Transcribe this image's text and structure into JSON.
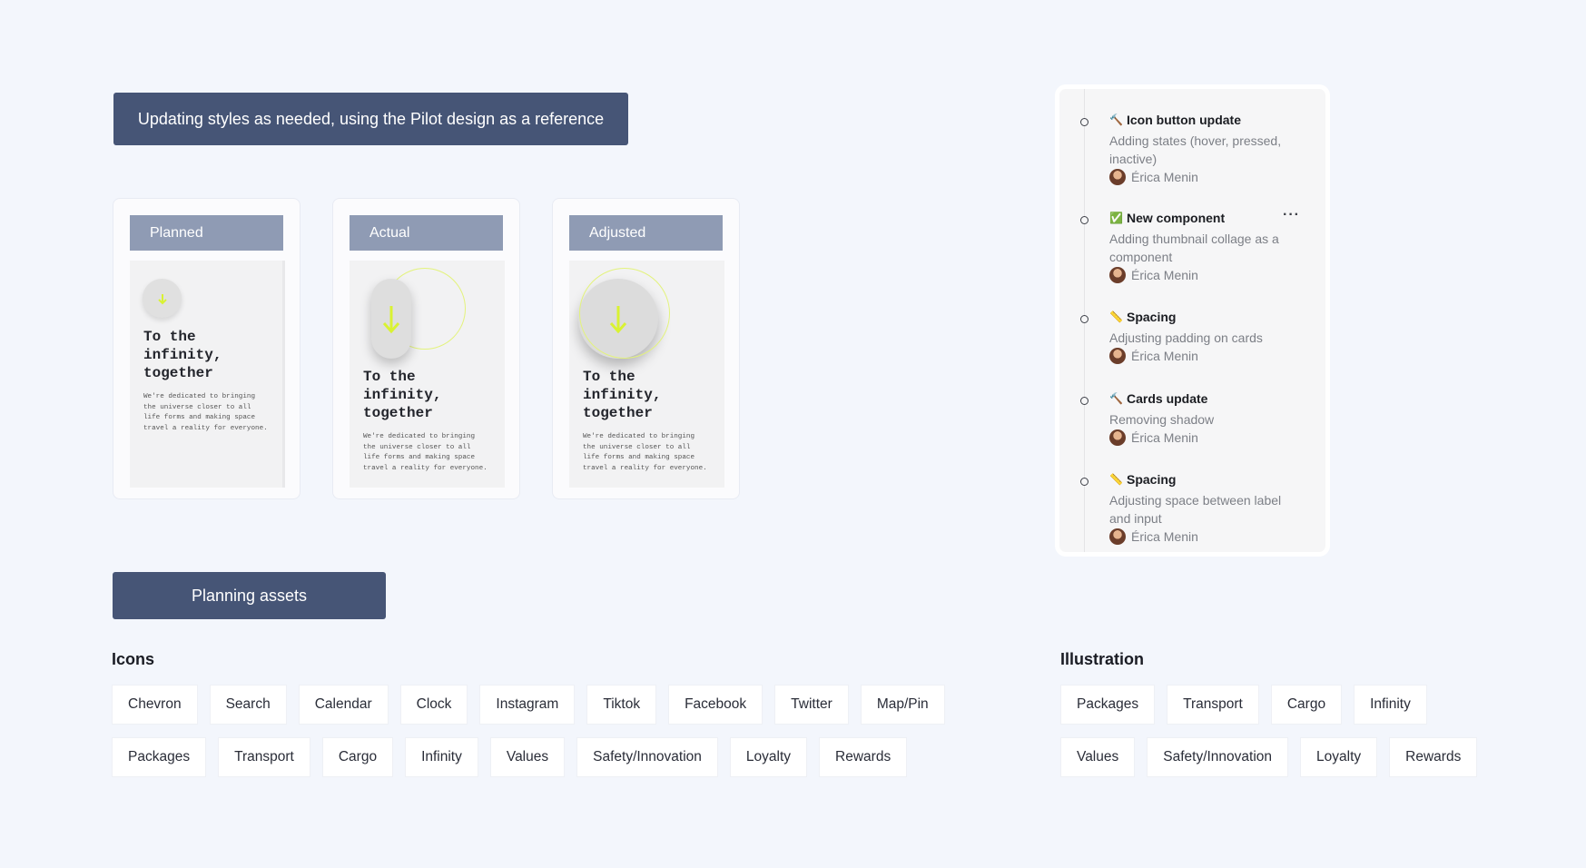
{
  "header": {
    "banner": "Updating styles as needed, using the Pilot design as a reference"
  },
  "cards": [
    {
      "label": "Planned",
      "title_lines": [
        "To the",
        "infinity,",
        "together"
      ],
      "text_lines": [
        "We're dedicated to bringing",
        "the universe closer to all",
        "life forms and making space",
        "travel a reality for everyone."
      ],
      "icon": "arrow-down-icon"
    },
    {
      "label": "Actual",
      "title_lines": [
        "To the",
        "infinity,",
        "together"
      ],
      "text_lines": [
        "We're dedicated to bringing",
        "the universe closer to all",
        "life forms and making space",
        "travel a reality for everyone."
      ],
      "icon": "arrow-down-icon"
    },
    {
      "label": "Adjusted",
      "title_lines": [
        "To the",
        "infinity,",
        "together"
      ],
      "text_lines": [
        "We're dedicated to bringing",
        "the universe closer to all",
        "life forms and making space",
        "travel a reality for everyone."
      ],
      "icon": "arrow-down-icon"
    }
  ],
  "activity": [
    {
      "emoji": "🔨",
      "title": "Icon button update",
      "description": "Adding states (hover, pressed, inactive)",
      "author": "Érica Menin"
    },
    {
      "emoji": "✅",
      "title": "New component",
      "description": "Adding thumbnail collage as a component",
      "author": "Érica Menin",
      "more": "···"
    },
    {
      "emoji": "📏",
      "title": "Spacing",
      "description": "Adjusting padding on cards",
      "author": "Érica Menin"
    },
    {
      "emoji": "🔨",
      "title": "Cards update",
      "description": "Removing shadow",
      "author": "Érica Menin"
    },
    {
      "emoji": "📏",
      "title": "Spacing",
      "description": "Adjusting space between label and input",
      "author": "Érica Menin"
    }
  ],
  "assets": {
    "banner": "Planning assets",
    "icons": {
      "title": "Icons",
      "row1": [
        "Chevron",
        "Search",
        "Calendar",
        "Clock",
        "Instagram",
        "Tiktok",
        "Facebook",
        "Twitter",
        "Map/Pin"
      ],
      "row2": [
        "Packages",
        "Transport",
        "Cargo",
        "Infinity",
        "Values",
        "Safety/Innovation",
        "Loyalty",
        "Rewards"
      ]
    },
    "illustration": {
      "title": "Illustration",
      "row1": [
        "Packages",
        "Transport",
        "Cargo",
        "Infinity"
      ],
      "row2": [
        "Values",
        "Safety/Innovation",
        "Loyalty",
        "Rewards"
      ]
    }
  },
  "colors": {
    "background": "#f3f6fc",
    "banner": "#465576",
    "card_label": "#8f9bb4",
    "accent_arrow": "#d9f233"
  }
}
